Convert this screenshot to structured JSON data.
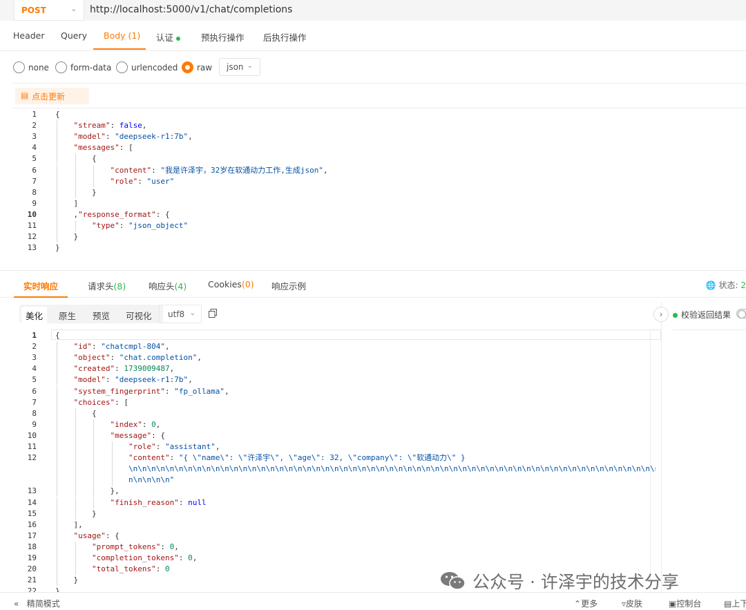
{
  "request": {
    "method": "POST",
    "url": "http://localhost:5000/v1/chat/completions"
  },
  "req_tabs": [
    {
      "label": "Header",
      "count": ""
    },
    {
      "label": "Query",
      "count": ""
    },
    {
      "label": "Body",
      "count": "(1)"
    },
    {
      "label": "认证",
      "count": ""
    },
    {
      "label": "预执行操作",
      "count": ""
    },
    {
      "label": "后执行操作",
      "count": ""
    }
  ],
  "body_types": [
    "none",
    "form-data",
    "urlencoded",
    "raw"
  ],
  "body_format": "json",
  "update_button": "点击更新",
  "request_code_lines": [
    {
      "n": "1",
      "indent": 0,
      "parts": [
        [
          "p",
          "{"
        ]
      ]
    },
    {
      "n": "2",
      "indent": 1,
      "parts": [
        [
          "k",
          "\"stream\""
        ],
        [
          "p",
          ": "
        ],
        [
          "b",
          "false"
        ],
        [
          "p",
          ","
        ]
      ]
    },
    {
      "n": "3",
      "indent": 1,
      "parts": [
        [
          "k",
          "\"model\""
        ],
        [
          "p",
          ": "
        ],
        [
          "s",
          "\"deepseek-r1:7b\""
        ],
        [
          "p",
          ","
        ]
      ]
    },
    {
      "n": "4",
      "indent": 1,
      "parts": [
        [
          "k",
          "\"messages\""
        ],
        [
          "p",
          ": ["
        ]
      ]
    },
    {
      "n": "5",
      "indent": 2,
      "parts": [
        [
          "p",
          "{"
        ]
      ]
    },
    {
      "n": "6",
      "indent": 3,
      "parts": [
        [
          "k",
          "\"content\""
        ],
        [
          "p",
          ": "
        ],
        [
          "s",
          "\"我是许泽宇，32岁在软通动力工作,生成json\""
        ],
        [
          "p",
          ","
        ]
      ]
    },
    {
      "n": "7",
      "indent": 3,
      "parts": [
        [
          "k",
          "\"role\""
        ],
        [
          "p",
          ": "
        ],
        [
          "s",
          "\"user\""
        ]
      ]
    },
    {
      "n": "8",
      "indent": 2,
      "parts": [
        [
          "p",
          "}"
        ]
      ]
    },
    {
      "n": "9",
      "indent": 1,
      "parts": [
        [
          "p",
          "]"
        ]
      ]
    },
    {
      "n": "10",
      "indent": 1,
      "parts": [
        [
          "p",
          ","
        ],
        [
          "k",
          "\"response_format\""
        ],
        [
          "p",
          ": {"
        ]
      ]
    },
    {
      "n": "11",
      "indent": 2,
      "parts": [
        [
          "k",
          "\"type\""
        ],
        [
          "p",
          ": "
        ],
        [
          "s",
          "\"json_object\""
        ]
      ]
    },
    {
      "n": "12",
      "indent": 1,
      "parts": [
        [
          "p",
          "}"
        ]
      ]
    },
    {
      "n": "13",
      "indent": 0,
      "parts": [
        [
          "p",
          "}"
        ]
      ]
    }
  ],
  "resp_tabs": [
    {
      "label": "实时响应",
      "count": ""
    },
    {
      "label": "请求头",
      "count": "(8)"
    },
    {
      "label": "响应头",
      "count": "(4)"
    },
    {
      "label": "Cookies",
      "count": "(0)"
    },
    {
      "label": "响应示例",
      "count": ""
    }
  ],
  "status_label": "状态:",
  "status_value": "2",
  "view_tabs": [
    "美化",
    "原生",
    "预览",
    "可视化"
  ],
  "encoding": "utf8",
  "verify_label": "校验返回结果",
  "response_code_lines": [
    {
      "n": "1",
      "indent": 0,
      "parts": [
        [
          "p",
          "{"
        ]
      ]
    },
    {
      "n": "2",
      "indent": 1,
      "parts": [
        [
          "k",
          "\"id\""
        ],
        [
          "p",
          ": "
        ],
        [
          "s",
          "\"chatcmpl-804\""
        ],
        [
          "p",
          ","
        ]
      ]
    },
    {
      "n": "3",
      "indent": 1,
      "parts": [
        [
          "k",
          "\"object\""
        ],
        [
          "p",
          ": "
        ],
        [
          "s",
          "\"chat.completion\""
        ],
        [
          "p",
          ","
        ]
      ]
    },
    {
      "n": "4",
      "indent": 1,
      "parts": [
        [
          "k",
          "\"created\""
        ],
        [
          "p",
          ": "
        ],
        [
          "n",
          "1739009487"
        ],
        [
          "p",
          ","
        ]
      ]
    },
    {
      "n": "5",
      "indent": 1,
      "parts": [
        [
          "k",
          "\"model\""
        ],
        [
          "p",
          ": "
        ],
        [
          "s",
          "\"deepseek-r1:7b\""
        ],
        [
          "p",
          ","
        ]
      ]
    },
    {
      "n": "6",
      "indent": 1,
      "parts": [
        [
          "k",
          "\"system_fingerprint\""
        ],
        [
          "p",
          ": "
        ],
        [
          "s",
          "\"fp_ollama\""
        ],
        [
          "p",
          ","
        ]
      ]
    },
    {
      "n": "7",
      "indent": 1,
      "parts": [
        [
          "k",
          "\"choices\""
        ],
        [
          "p",
          ": ["
        ]
      ]
    },
    {
      "n": "8",
      "indent": 2,
      "parts": [
        [
          "p",
          "{"
        ]
      ]
    },
    {
      "n": "9",
      "indent": 3,
      "parts": [
        [
          "k",
          "\"index\""
        ],
        [
          "p",
          ": "
        ],
        [
          "n",
          "0"
        ],
        [
          "p",
          ","
        ]
      ]
    },
    {
      "n": "10",
      "indent": 3,
      "parts": [
        [
          "k",
          "\"message\""
        ],
        [
          "p",
          ": {"
        ]
      ]
    },
    {
      "n": "11",
      "indent": 4,
      "parts": [
        [
          "k",
          "\"role\""
        ],
        [
          "p",
          ": "
        ],
        [
          "s",
          "\"assistant\""
        ],
        [
          "p",
          ","
        ]
      ]
    },
    {
      "n": "12",
      "indent": 4,
      "parts": [
        [
          "k",
          "\"content\""
        ],
        [
          "p",
          ": "
        ],
        [
          "s",
          "\"{ \\\"name\\\": \\\"许泽宇\\\", \\\"age\\\": 32, \\\"company\\\": \\\"软通动力\\\" }"
        ]
      ]
    },
    {
      "n": "",
      "indent": 4,
      "parts": [
        [
          "s",
          "\\n\\n\\n\\n\\n\\n\\n\\n\\n\\n\\n\\n\\n\\n\\n\\n\\n\\n\\n\\n\\n\\n\\n\\n\\n\\n\\n\\n\\n\\n\\n\\n\\n\\n\\n\\n\\n\\n\\n\\n\\n\\n\\n\\n\\n\\n\\n\\n\\n\\n\\n\\n\\n\\n\\n\\n\\n\\n\\n\\n\\n\\n\\n\\n\\n\\n\\n\\n\\n\\n\\n\\n\\n\\n\\n\\n\\n\\n\\n\\n\\n\\n\\n\\n\\n\\n\\n\\n\\n\\n\\n\\n\\n\\n\\n\\n\\n\\n\\n\\n\\n\\n\\n\\n\\n\\n\\n\\n\\n\\n\\n\\n\\n\\n\\n\\n\\n\\n\\n\\n\\n\\n\\n\\n\\n\\n\\n\\n\\n\\n\\n\\n\\n\\n\\n\\n\\n\\n\\n\\n\\n\\n\\n\\n\\n\\n\\n\\n\\n\\n\\n\\n\\n\\n\\n\\n\\n\\n\\n\\n\\n\\n\\n\\n\\n\\n\\n\\n\\n\\n\\n\\n\\n\\n\\n\\n\\n\\n\\n\\n\\n\\n\\n\\n\\n\\n\\n\\n\\n\\n\\n\\n\\n\\n\\n\\n\\n\\n\\n\\n\\n\\n\\n\\n\\n\\n\\n\\n\\n\\n\\"
        ]
      ]
    },
    {
      "n": "",
      "indent": 4,
      "parts": [
        [
          "s",
          "n\\n\\n\\n\\n\""
        ]
      ]
    },
    {
      "n": "13",
      "indent": 3,
      "parts": [
        [
          "p",
          "},"
        ]
      ]
    },
    {
      "n": "14",
      "indent": 3,
      "parts": [
        [
          "k",
          "\"finish_reason\""
        ],
        [
          "p",
          ": "
        ],
        [
          "b",
          "null"
        ]
      ]
    },
    {
      "n": "15",
      "indent": 2,
      "parts": [
        [
          "p",
          "}"
        ]
      ]
    },
    {
      "n": "16",
      "indent": 1,
      "parts": [
        [
          "p",
          "],"
        ]
      ]
    },
    {
      "n": "17",
      "indent": 1,
      "parts": [
        [
          "k",
          "\"usage\""
        ],
        [
          "p",
          ": {"
        ]
      ]
    },
    {
      "n": "18",
      "indent": 2,
      "parts": [
        [
          "k",
          "\"prompt_tokens\""
        ],
        [
          "p",
          ": "
        ],
        [
          "n",
          "0"
        ],
        [
          "p",
          ","
        ]
      ]
    },
    {
      "n": "19",
      "indent": 2,
      "parts": [
        [
          "k",
          "\"completion_tokens\""
        ],
        [
          "p",
          ": "
        ],
        [
          "n",
          "0"
        ],
        [
          "p",
          ","
        ]
      ]
    },
    {
      "n": "20",
      "indent": 2,
      "parts": [
        [
          "k",
          "\"total_tokens\""
        ],
        [
          "p",
          ": "
        ],
        [
          "n",
          "0"
        ]
      ]
    },
    {
      "n": "21",
      "indent": 1,
      "parts": [
        [
          "p",
          "}"
        ]
      ]
    },
    {
      "n": "22",
      "indent": 0,
      "parts": [
        [
          "p",
          "}"
        ]
      ]
    }
  ],
  "bottom_bar": {
    "simple_mode": "精简模式",
    "more": "更多",
    "skin": "皮肤",
    "console": "控制台",
    "top": "上下"
  },
  "watermark": "公众号 · 许泽宇的技术分享",
  "colors": {
    "accent": "#ff7a00",
    "ok": "#2cb84c",
    "json_key": "#a31515",
    "json_string": "#0451a5",
    "json_number": "#098658",
    "json_keyword": "#0000ff"
  }
}
